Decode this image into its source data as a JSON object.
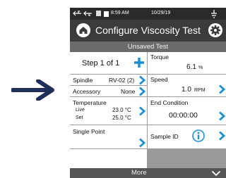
{
  "status": {
    "time": "8:59 AM",
    "date": "10/29/19"
  },
  "header": {
    "title": "Configure Viscosity Test"
  },
  "subheader": {
    "label": "Unsaved Test"
  },
  "step": {
    "label": "Step 1 of 1"
  },
  "torque": {
    "label": "Torque",
    "value": "6.1",
    "unit": "%"
  },
  "spindle": {
    "label": "Spindle",
    "value": "RV-02 (2)"
  },
  "accessory": {
    "label": "Accessory",
    "value": "None"
  },
  "speed": {
    "label": "Speed",
    "value": "1.0",
    "unit": "RPM"
  },
  "temperature": {
    "label": "Temperature",
    "live_label": "Live",
    "live_value": "23.0 °C",
    "set_label": "Set",
    "set_value": "25.0 °C"
  },
  "end_condition": {
    "label": "End Condition",
    "value": "00:00:00"
  },
  "single_point": {
    "label": "Single Point"
  },
  "sample_id": {
    "label": "Sample ID"
  },
  "footer": {
    "more_label": "More"
  },
  "colors": {
    "accent": "#1b8fd6",
    "arrow": "#1f2f57"
  },
  "icons": [
    "arrow-right-icon",
    "home-icon",
    "gear-icon",
    "plus-icon",
    "chevron-right-icon",
    "info-icon",
    "chevron-down-icon",
    "usb-icon",
    "battery-icon"
  ]
}
